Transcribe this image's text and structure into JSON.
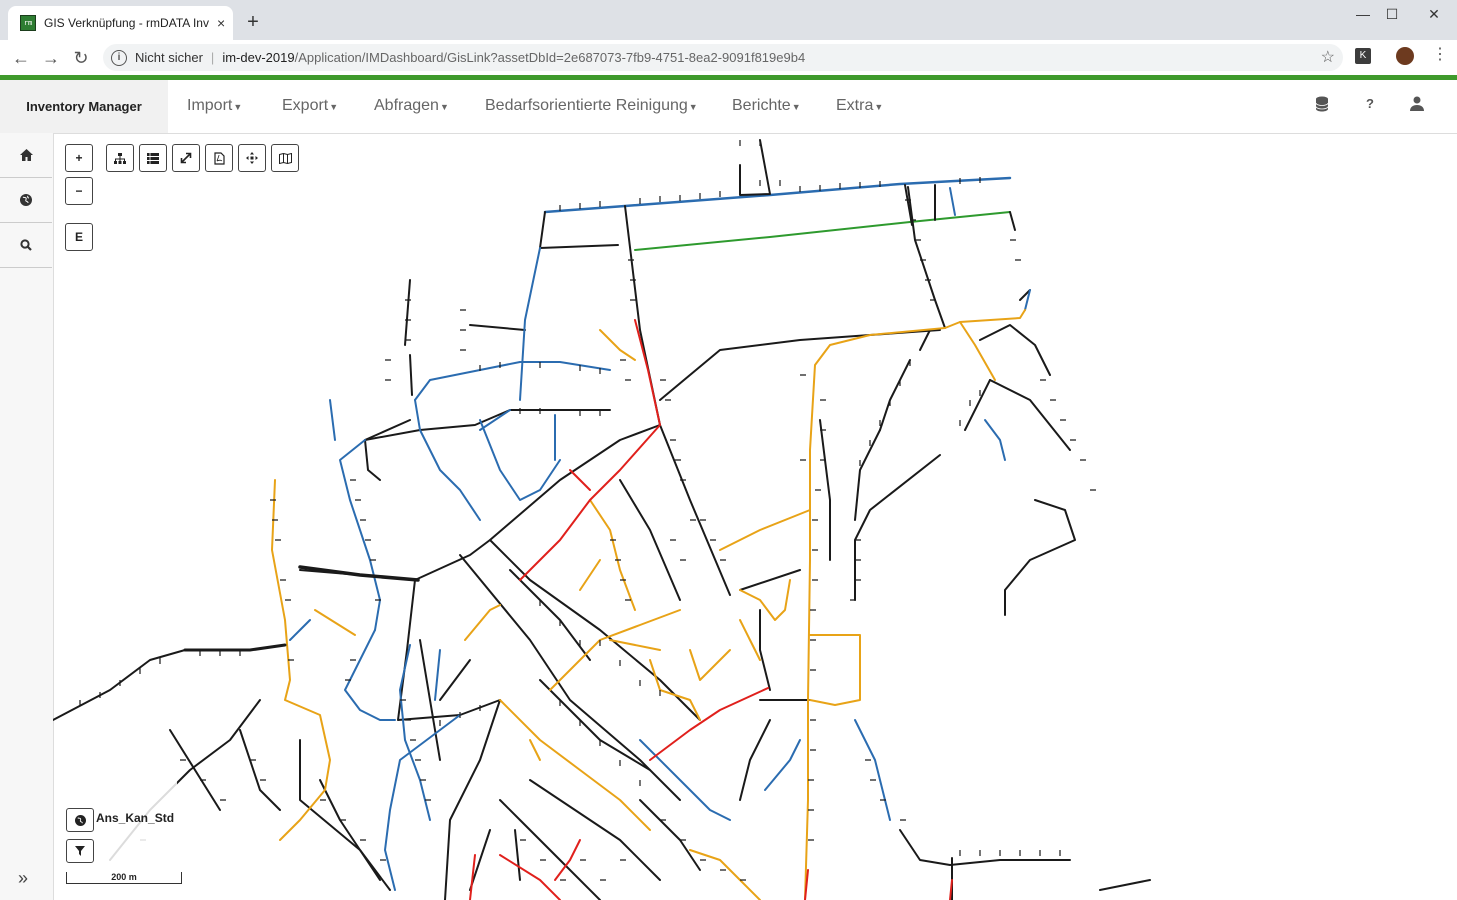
{
  "browser": {
    "tab_title": "GIS Verknüpfung - rmDATA Inven",
    "tab_close": "×",
    "new_tab": "+",
    "security_label": "Nicht sicher",
    "url_host": "im-dev-2019",
    "url_path": "/Application/IMDashboard/GisLink?assetDbId=2e687073-7fb9-4751-8ea2-9091f819e9b4",
    "extension_label": "K"
  },
  "app": {
    "brand": "Inventory Manager",
    "menu": [
      "Import",
      "Export",
      "Abfragen",
      "Bedarfsorientierte Reinigung",
      "Berichte",
      "Extra"
    ],
    "header_icons": [
      "database-icon",
      "help-icon",
      "user-icon"
    ]
  },
  "sidebar": {
    "items": [
      "home-icon",
      "globe-icon",
      "search-icon"
    ],
    "expand": "»"
  },
  "map": {
    "zoom_in": "+",
    "zoom_out": "−",
    "edit_label": "E",
    "tools": [
      "sitemap-icon",
      "list-icon",
      "expand-icon",
      "pdf-icon",
      "move-icon",
      "map-icon"
    ],
    "layer_name": "Ans_Kan_Std",
    "scale_label": "200 m",
    "colors": {
      "black": "#1a1a1a",
      "blue": "#2b6cb0",
      "orange": "#e8a317",
      "red": "#e0201c",
      "green": "#2e9a2e"
    }
  }
}
